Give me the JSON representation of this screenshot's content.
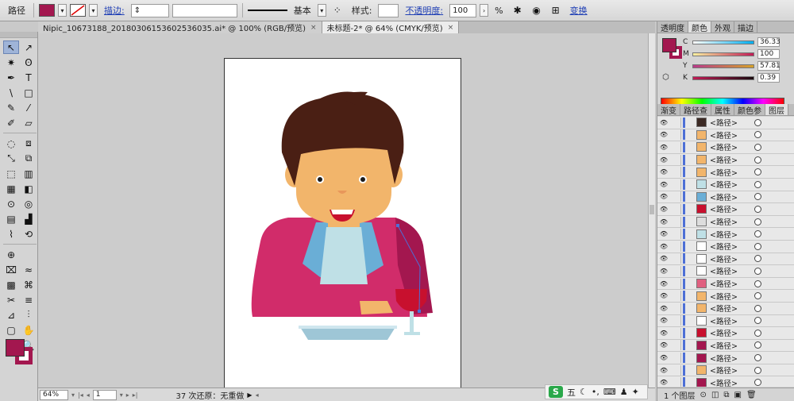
{
  "control_bar": {
    "object_type": "路径",
    "fill_color": "#a3174f",
    "stroke_label": "描边:",
    "stroke_style": "基本",
    "style_label": "样式:",
    "opacity_label": "不透明度:",
    "opacity_value": "100",
    "opacity_unit": "%",
    "transform_label": "变换"
  },
  "tabs": [
    {
      "label": "Nipic_10673188_20180306153602536035.ai* @ 100% (RGB/预览)",
      "close": "×"
    },
    {
      "label": "未标题-2* @ 64% (CMYK/预览)",
      "close": "×"
    }
  ],
  "tools": [
    "↖",
    "↗",
    "✷",
    "ʘ",
    "✒",
    "T",
    "\\",
    "□",
    "✎",
    "⁄",
    "✐",
    "▱",
    "◌",
    "⧈",
    "⤡",
    "⧉",
    "⬚",
    "▥",
    "▦",
    "◧",
    "⊙",
    "◎",
    "▤",
    "▟",
    "⌇",
    "⟲",
    "⊕",
    "",
    "⌧",
    "≈",
    "▩",
    "⌘",
    "✂",
    "≡",
    "⊿",
    "⫶",
    "▢",
    "✋",
    "⌕",
    "🔍"
  ],
  "right_panel": {
    "top_tabs": [
      "透明度",
      "颜色",
      "外观",
      "描边"
    ],
    "active_top_tab": "颜色",
    "cmyk": [
      {
        "channel": "C",
        "value": "36.33"
      },
      {
        "channel": "M",
        "value": "100"
      },
      {
        "channel": "Y",
        "value": "57.81"
      },
      {
        "channel": "K",
        "value": "0.39"
      }
    ],
    "layer_tabs": [
      "渐变",
      "路径查",
      "属性",
      "颜色参",
      "图层"
    ],
    "active_layer_tab": "图层",
    "layers": [
      {
        "name": "<路径>",
        "swatch": "#3c2a24"
      },
      {
        "name": "<路径>",
        "swatch": "#f2b56b"
      },
      {
        "name": "<路径>",
        "swatch": "#f2b56b"
      },
      {
        "name": "<路径>",
        "swatch": "#f2b56b"
      },
      {
        "name": "<路径>",
        "swatch": "#f2b56b"
      },
      {
        "name": "<路径>",
        "swatch": "#bfe0e6"
      },
      {
        "name": "<路径>",
        "swatch": "#6aaed6"
      },
      {
        "name": "<路径>",
        "swatch": "#c8102e"
      },
      {
        "name": "<路径>",
        "swatch": "#dddddd"
      },
      {
        "name": "<路径>",
        "swatch": "#bfe0e6"
      },
      {
        "name": "<路径>",
        "swatch": "#ffffff"
      },
      {
        "name": "<路径>",
        "swatch": "#ffffff"
      },
      {
        "name": "<路径>",
        "swatch": "#ffffff"
      },
      {
        "name": "<路径>",
        "swatch": "#e06080"
      },
      {
        "name": "<路径>",
        "swatch": "#f2b56b"
      },
      {
        "name": "<路径>",
        "swatch": "#f2b56b"
      },
      {
        "name": "<路径>",
        "swatch": "#ffffff"
      },
      {
        "name": "<路径>",
        "swatch": "#c8102e"
      },
      {
        "name": "<路径>",
        "swatch": "#a3174f"
      },
      {
        "name": "<路径>",
        "swatch": "#a3174f"
      },
      {
        "name": "<路径>",
        "swatch": "#f2b56b"
      },
      {
        "name": "<路径>",
        "swatch": "#a3174f"
      }
    ],
    "layer_count": "1 个图层"
  },
  "status_bar": {
    "zoom": "64%",
    "page": "1",
    "history": "37 次还原：无重做"
  },
  "ime": {
    "logo": "S",
    "mode": "五"
  }
}
